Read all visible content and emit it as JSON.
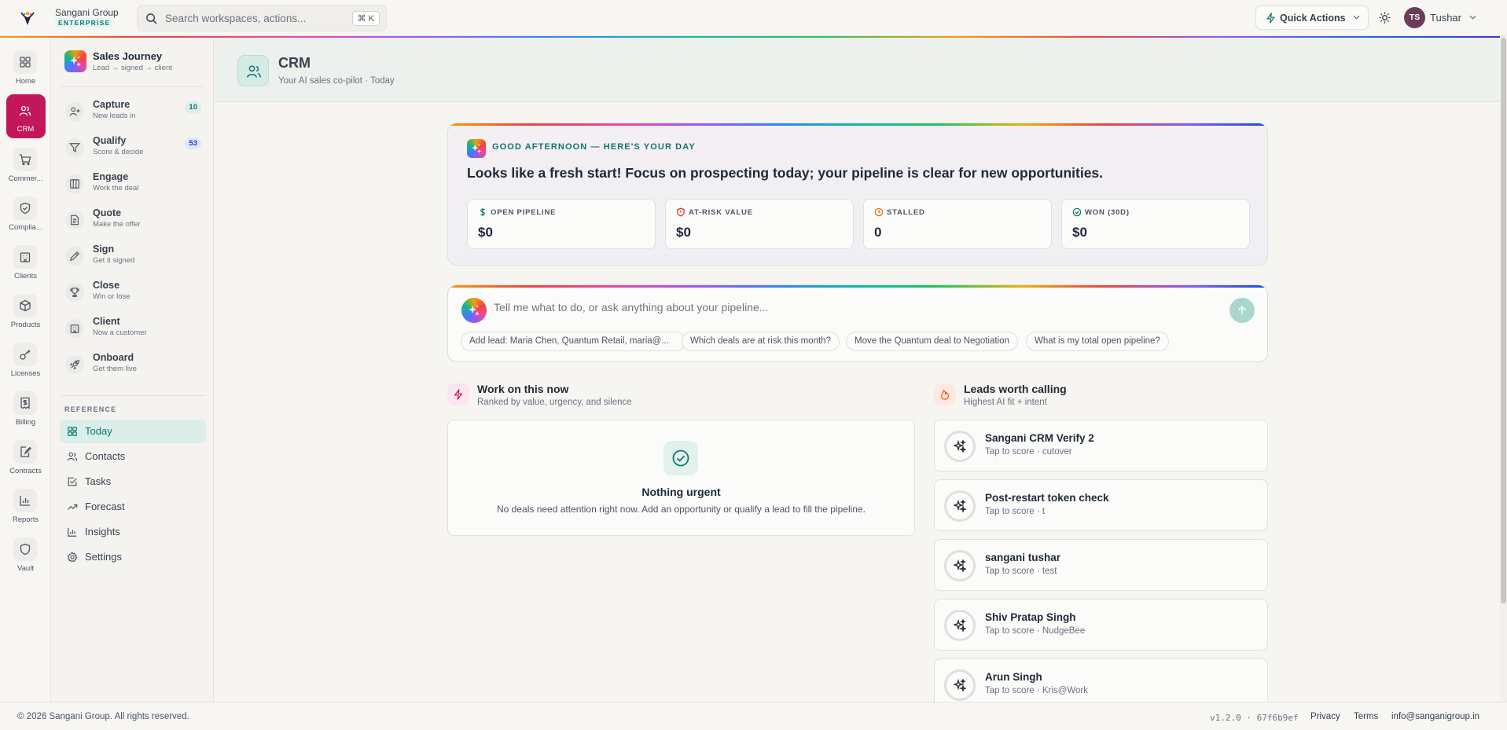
{
  "brand": {
    "name": "Sangani Group",
    "tier": "ENTERPRISE",
    "logo_icon": "sangani-logo-icon"
  },
  "topbar": {
    "search_placeholder": "Search workspaces, actions...",
    "search_shortcut": "⌘ K",
    "quick_actions_label": "Quick Actions",
    "user_initials": "TS",
    "user_name": "Tushar"
  },
  "rail": [
    {
      "label": "Home",
      "icon": "grid-icon"
    },
    {
      "label": "CRM",
      "icon": "users-icon",
      "active": true
    },
    {
      "label": "Commer...",
      "icon": "cart-icon"
    },
    {
      "label": "Complia...",
      "icon": "shield-check-icon"
    },
    {
      "label": "Clients",
      "icon": "building-icon"
    },
    {
      "label": "Products",
      "icon": "box-icon"
    },
    {
      "label": "Licenses",
      "icon": "key-icon"
    },
    {
      "label": "Billing",
      "icon": "receipt-icon"
    },
    {
      "label": "Contracts",
      "icon": "contract-icon"
    },
    {
      "label": "Reports",
      "icon": "bar-chart-icon"
    },
    {
      "label": "Vault",
      "icon": "vault-shield-icon"
    }
  ],
  "sidebar": {
    "title": "Sales Journey",
    "subtitle": "Lead → signed → client",
    "stages": [
      {
        "name": "Capture",
        "sub": "New leads in",
        "badge": "10",
        "icon": "user-plus-icon"
      },
      {
        "name": "Qualify",
        "sub": "Score & decide",
        "badge": "53",
        "icon": "filter-icon"
      },
      {
        "name": "Engage",
        "sub": "Work the deal",
        "badge": "",
        "icon": "columns-icon"
      },
      {
        "name": "Quote",
        "sub": "Make the offer",
        "badge": "",
        "icon": "file-text-icon"
      },
      {
        "name": "Sign",
        "sub": "Get it signed",
        "badge": "",
        "icon": "pen-icon"
      },
      {
        "name": "Close",
        "sub": "Win or lose",
        "badge": "",
        "icon": "trophy-icon"
      },
      {
        "name": "Client",
        "sub": "Now a customer",
        "badge": "",
        "icon": "building-icon"
      },
      {
        "name": "Onboard",
        "sub": "Get them live",
        "badge": "",
        "icon": "rocket-icon"
      }
    ],
    "reference_label": "REFERENCE",
    "reference": [
      {
        "label": "Today",
        "icon": "grid-icon",
        "active": true
      },
      {
        "label": "Contacts",
        "icon": "users-icon"
      },
      {
        "label": "Tasks",
        "icon": "check-square-icon"
      },
      {
        "label": "Forecast",
        "icon": "trend-up-icon"
      },
      {
        "label": "Insights",
        "icon": "bar-chart-icon"
      },
      {
        "label": "Settings",
        "icon": "gear-icon"
      }
    ]
  },
  "header": {
    "title": "CRM",
    "subtitle": "Your AI sales co-pilot · Today"
  },
  "summary": {
    "greeting": "GOOD AFTERNOON — HERE'S YOUR DAY",
    "headline": "Looks like a fresh start! Focus on prospecting today; your pipeline is clear for new opportunities.",
    "metrics": [
      {
        "label": "OPEN PIPELINE",
        "value": "$0",
        "icon": "dollar-icon",
        "color": "#0f766e"
      },
      {
        "label": "AT-RISK VALUE",
        "value": "$0",
        "icon": "shield-alert-icon",
        "color": "#dc2626"
      },
      {
        "label": "STALLED",
        "value": "0",
        "icon": "clock-icon",
        "color": "#d97706"
      },
      {
        "label": "WON (30D)",
        "value": "$0",
        "icon": "check-circle-icon",
        "color": "#0f766e"
      }
    ]
  },
  "prompt": {
    "placeholder": "Tell me what to do, or ask anything about your pipeline...",
    "chips": [
      "Add lead: Maria Chen, Quantum Retail, maria@...",
      "Which deals are at risk this month?",
      "Move the Quantum deal to Negotiation",
      "What is my total open pipeline?"
    ]
  },
  "work": {
    "title": "Work on this now",
    "subtitle": "Ranked by value, urgency, and silence",
    "empty_title": "Nothing urgent",
    "empty_text": "No deals need attention right now. Add an opportunity or qualify a lead to fill the pipeline."
  },
  "leads": {
    "title": "Leads worth calling",
    "subtitle": "Highest AI fit + intent",
    "items": [
      {
        "name": "Sangani CRM Verify 2",
        "sub": "Tap to score · cutover"
      },
      {
        "name": "Post-restart token check",
        "sub": "Tap to score · t"
      },
      {
        "name": "sangani tushar",
        "sub": "Tap to score · test"
      },
      {
        "name": "Shiv Pratap Singh",
        "sub": "Tap to score · NudgeBee"
      },
      {
        "name": "Arun Singh",
        "sub": "Tap to score · Kris@Work"
      }
    ]
  },
  "footer": {
    "copyright": "© 2026 Sangani Group. All rights reserved.",
    "version": "v1.2.0 · 67f6b9ef",
    "links": [
      "Privacy",
      "Terms",
      "info@sanganigroup.in"
    ]
  },
  "colors": {
    "accent": "#0f766e",
    "crm_active": "#c2185b"
  }
}
